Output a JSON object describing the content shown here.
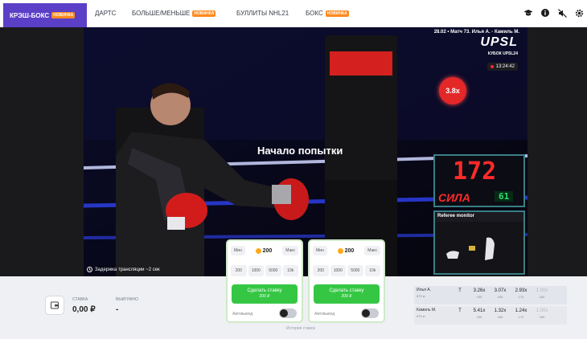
{
  "nav": {
    "active_tab": "КРЭШ-БОКС",
    "active_badge": "НОВИНКА",
    "tabs": [
      {
        "label": "ДАРТС",
        "badge": ""
      },
      {
        "label": "БОЛЬШЕ/МЕНЬШЕ",
        "badge": "НОВИНКА"
      },
      {
        "label": "БУЛЛИТЫ NHL21",
        "badge": ""
      },
      {
        "label": "БОКС",
        "badge": "НОВИНКА"
      }
    ],
    "icons": [
      "graduation-cap-icon",
      "info-icon",
      "mute-icon",
      "settings-icon"
    ]
  },
  "stream": {
    "match_info": "28.02 • Матч 73. Илья А. - Камиль М.",
    "league": "UPSL",
    "cup": "КУБОК UPSL24",
    "live_time": "13:24:42",
    "multiplier": "3.8x",
    "attempt_text": "Начало попытки",
    "delay_text": "Задержка трансляции ~2 сек",
    "power_value": "172",
    "power_label": "СИЛА",
    "power_sub": "61",
    "referee_label": "Referee monitor"
  },
  "wallet": {
    "stake_label": "СТАВКА",
    "stake_value": "0,00 ₽",
    "won_label": "ВЫИГРАНО",
    "won_value": "-"
  },
  "bets": [
    {
      "min": "Мин",
      "max": "Макс",
      "amount": "200",
      "chips": [
        "200",
        "1000",
        "5000",
        "10k"
      ],
      "button": "Сделать ставку",
      "button_sub": "200 ₽",
      "auto": "Автовывод",
      "auto_on": false
    },
    {
      "min": "Мин",
      "max": "Макс",
      "amount": "200",
      "chips": [
        "200",
        "1000",
        "5000",
        "10k"
      ],
      "button": "Сделать ставку",
      "button_sub": "200 ₽",
      "auto": "Автовывод",
      "auto_on": false
    }
  ],
  "under_label": "История ставок",
  "odds": [
    {
      "name": "Илья А.",
      "sub": "670 кг",
      "marker": "Т",
      "cells": [
        {
          "v": "3.26x",
          "p": "150",
          "dim": false
        },
        {
          "v": "3.07x",
          "p": "160",
          "dim": false
        },
        {
          "v": "2.93x",
          "p": "170",
          "dim": false
        },
        {
          "v": "1.00x",
          "p": "180",
          "dim": true
        }
      ]
    },
    {
      "name": "Камиль М.",
      "sub": "670 кг",
      "marker": "Т",
      "cells": [
        {
          "v": "5.41x",
          "p": "150",
          "dim": false
        },
        {
          "v": "1.32x",
          "p": "160",
          "dim": false
        },
        {
          "v": "1.24x",
          "p": "170",
          "dim": false
        },
        {
          "v": "1.00x",
          "p": "180",
          "dim": true
        }
      ]
    }
  ],
  "colors": {
    "accent": "#5b3fc7",
    "badge": "#ff8a1f",
    "bet_green": "#35c744",
    "multiplier": "#e42828"
  }
}
